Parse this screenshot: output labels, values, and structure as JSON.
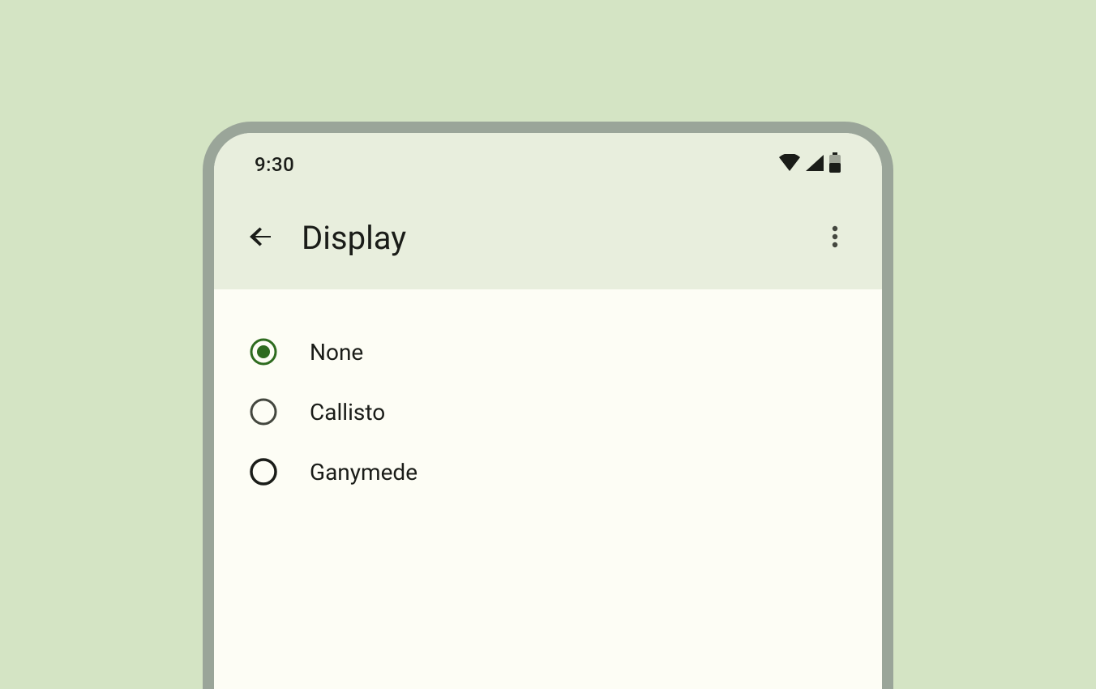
{
  "statusBar": {
    "time": "9:30"
  },
  "appBar": {
    "title": "Display"
  },
  "options": [
    {
      "label": "None",
      "selected": true
    },
    {
      "label": "Callisto",
      "selected": false
    },
    {
      "label": "Ganymede",
      "selected": false
    }
  ],
  "colors": {
    "radioSelected": "#2e6b1f",
    "radioUnselected": "#44473f"
  }
}
